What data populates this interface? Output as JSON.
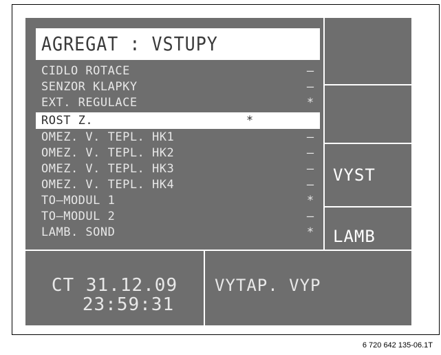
{
  "title": "AGREGAT : VSTUPY",
  "rows": [
    {
      "label": "CIDLO ROTACE",
      "value": "–"
    },
    {
      "label": "SENZOR KLAPKY",
      "value": "–"
    },
    {
      "label": "EXT. REGULACE",
      "value": "*"
    },
    {
      "label": "ROST Z.",
      "value": "*"
    },
    {
      "label": "OMEZ. V. TEPL. HK1",
      "value": "–"
    },
    {
      "label": "OMEZ. V. TEPL. HK2",
      "value": "–"
    },
    {
      "label": "OMEZ. V. TEPL. HK3",
      "value": "–"
    },
    {
      "label": "OMEZ. V. TEPL. HK4",
      "value": "–"
    },
    {
      "label": "TO–MODUL 1",
      "value": "*"
    },
    {
      "label": "TO–MODUL 2",
      "value": "–"
    },
    {
      "label": "LAMB. SOND",
      "value": "*"
    }
  ],
  "softkeys": {
    "key3": "VYST",
    "key4": "LAMB"
  },
  "footer": {
    "date": "CT 31.12.09",
    "time": "23:59:31",
    "status": "VYTAP. VYP"
  },
  "caption": "6 720 642 135-06.1T",
  "colors": {
    "lcd_background": "#6e6e6e",
    "text": "#e7e7e7",
    "highlight": "#ffffff"
  }
}
